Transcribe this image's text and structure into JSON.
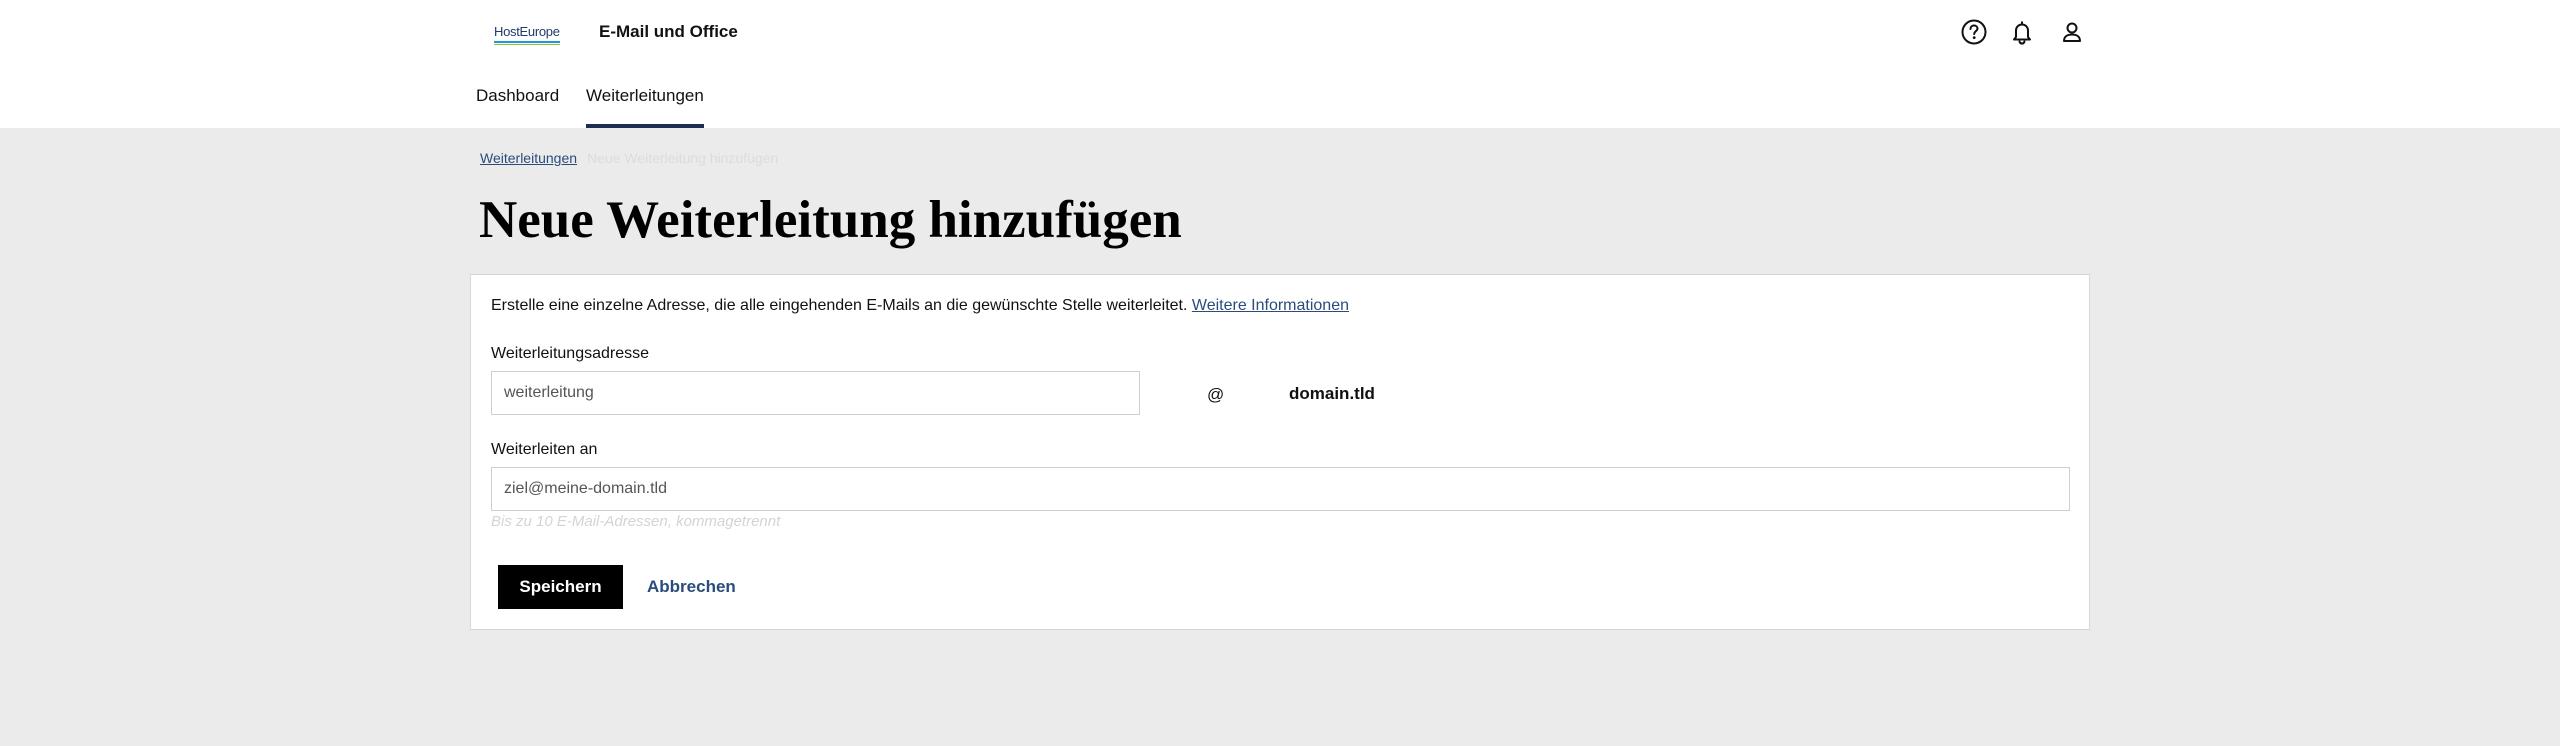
{
  "header": {
    "logo_text": "HostEurope",
    "app_title": "E-Mail und Office",
    "icons": [
      "help-icon",
      "bell-icon",
      "user-icon"
    ]
  },
  "nav": {
    "tabs": [
      {
        "label": "Dashboard",
        "active": false
      },
      {
        "label": "Weiterleitungen",
        "active": true
      }
    ]
  },
  "breadcrumb": {
    "parent": "Weiterleitungen",
    "current": "Neue Weiterleitung hinzufügen"
  },
  "page_title": "Neue Weiterleitung hinzufügen",
  "form": {
    "intro_text": "Erstelle eine einzelne Adresse, die alle eingehenden E-Mails an die gewünschte Stelle weiterleitet.",
    "intro_link": "Weitere Informationen",
    "address_label": "Weiterleitungsadresse",
    "address_placeholder": "weiterleitung",
    "at_sign": "@",
    "domain": "domain.tld",
    "target_label": "Weiterleiten an",
    "target_placeholder": "ziel@meine-domain.tld",
    "target_hint": "Bis zu 10 E-Mail-Adressen, kommagetrennt",
    "save_label": "Speichern",
    "cancel_label": "Abbrechen"
  },
  "colors": {
    "page_bg": "#ebebeb",
    "accent": "#1f2d54",
    "link": "#2a4c7d",
    "button": "#000000"
  }
}
